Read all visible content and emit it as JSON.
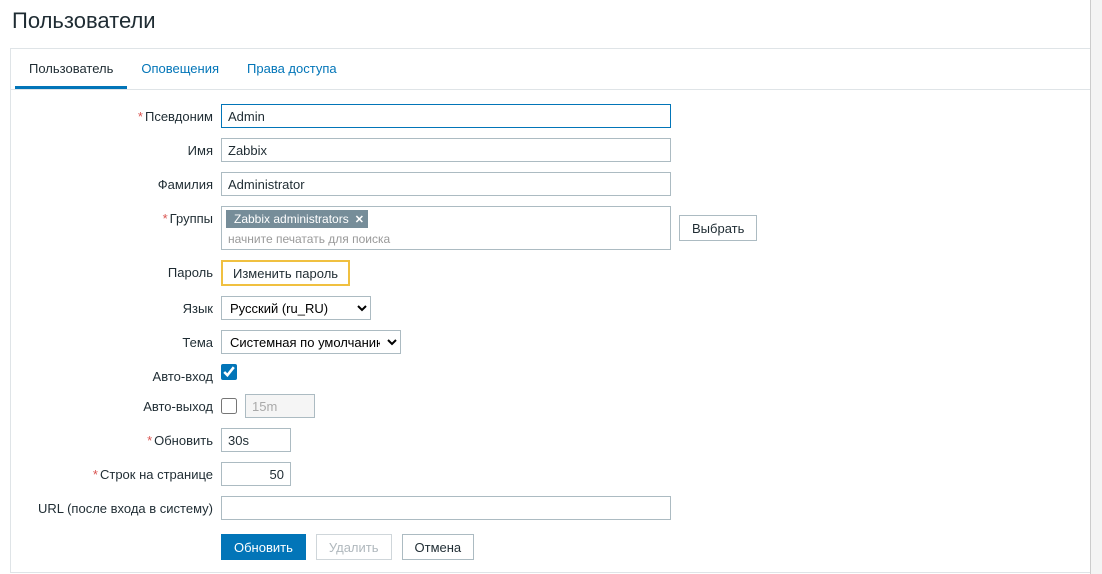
{
  "page": {
    "title": "Пользователи"
  },
  "tabs": [
    {
      "label": "Пользователь",
      "active": true
    },
    {
      "label": "Оповещения",
      "active": false
    },
    {
      "label": "Права доступа",
      "active": false
    }
  ],
  "labels": {
    "alias": "Псевдоним",
    "name": "Имя",
    "surname": "Фамилия",
    "groups": "Группы",
    "password": "Пароль",
    "language": "Язык",
    "theme": "Тема",
    "autologin": "Авто-вход",
    "autologout": "Авто-выход",
    "refresh": "Обновить",
    "rows": "Строк на странице",
    "url": "URL (после входа в систему)"
  },
  "values": {
    "alias": "Admin",
    "name": "Zabbix",
    "surname": "Administrator",
    "group_tag": "Zabbix administrators",
    "groups_placeholder": "начните печатать для поиска",
    "language_selected": "Русский (ru_RU)",
    "theme_selected": "Системная по умолчанию",
    "autologin_checked": true,
    "autologout_checked": false,
    "autologout_value": "15m",
    "refresh": "30s",
    "rows": "50",
    "url": ""
  },
  "buttons": {
    "select": "Выбрать",
    "change_password": "Изменить пароль",
    "update": "Обновить",
    "delete": "Удалить",
    "cancel": "Отмена"
  }
}
